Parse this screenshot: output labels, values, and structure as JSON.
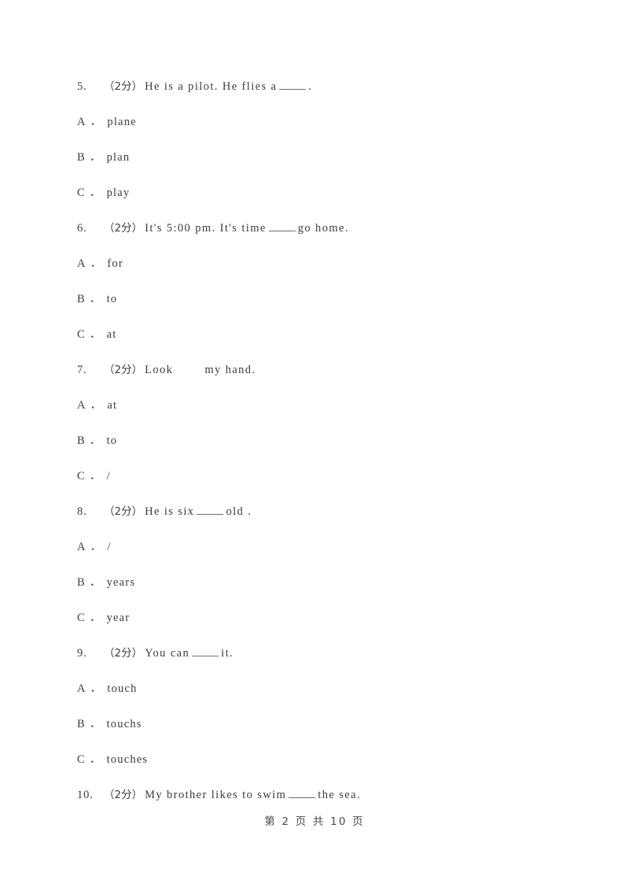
{
  "document": {
    "page_background": "#ffffff",
    "text_color": "#3c3c3c",
    "rule_color": "#6e6e6e"
  },
  "footer": {
    "text": "第 2 页 共 10 页",
    "page_number": "2",
    "total_pages": "10"
  },
  "questions": [
    {
      "number": "5.",
      "marks": "（2分）",
      "stem_before": "He is a pilot. He flies a",
      "blank": "underline",
      "stem_after": ".",
      "options": [
        {
          "letter": "A",
          "sep": "．",
          "text": "plane"
        },
        {
          "letter": "B",
          "sep": "．",
          "text": "plan"
        },
        {
          "letter": "C",
          "sep": "．",
          "text": "play"
        }
      ]
    },
    {
      "number": "6.",
      "marks": "（2分）",
      "stem_before": "It's 5:00 pm. It's time",
      "blank": "underline",
      "stem_after": "go home.",
      "options": [
        {
          "letter": "A",
          "sep": "．",
          "text": "for"
        },
        {
          "letter": "B",
          "sep": "．",
          "text": "to"
        },
        {
          "letter": "C",
          "sep": "．",
          "text": "at"
        }
      ]
    },
    {
      "number": "7.",
      "marks": "（2分）",
      "stem_before": "Look",
      "blank": "space",
      "stem_after": "my hand.",
      "options": [
        {
          "letter": "A",
          "sep": "．",
          "text": "at"
        },
        {
          "letter": "B",
          "sep": "．",
          "text": "to"
        },
        {
          "letter": "C",
          "sep": "．",
          "text": "/"
        }
      ]
    },
    {
      "number": "8.",
      "marks": "（2分）",
      "stem_before": "He is six",
      "blank": "underline",
      "stem_after": "old .",
      "options": [
        {
          "letter": "A",
          "sep": "．",
          "text": "/"
        },
        {
          "letter": "B",
          "sep": "．",
          "text": "years"
        },
        {
          "letter": "C",
          "sep": "．",
          "text": "year"
        }
      ]
    },
    {
      "number": "9.",
      "marks": "（2分）",
      "stem_before": "You can",
      "blank": "underline",
      "stem_after": "it.",
      "options": [
        {
          "letter": "A",
          "sep": "．",
          "text": "touch"
        },
        {
          "letter": "B",
          "sep": "．",
          "text": "touchs"
        },
        {
          "letter": "C",
          "sep": "．",
          "text": "touches"
        }
      ]
    },
    {
      "number": "10.",
      "marks": "（2分）",
      "stem_before": "My brother likes to swim",
      "blank": "underline",
      "stem_after": "the sea.",
      "options": []
    }
  ]
}
